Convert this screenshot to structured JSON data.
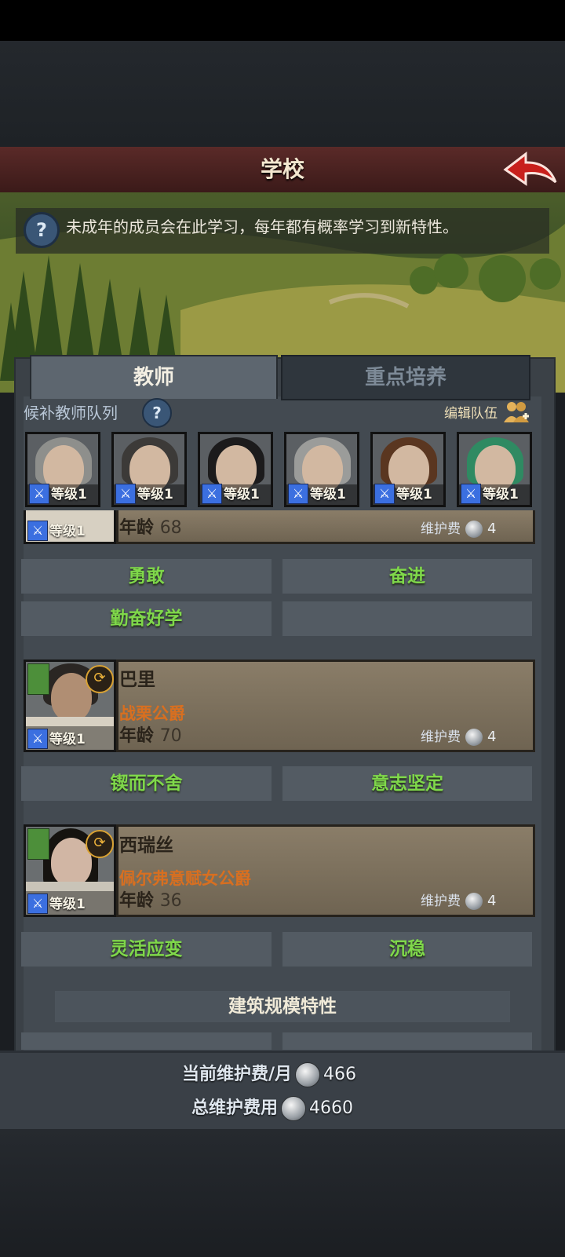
{
  "header": {
    "title": "学校"
  },
  "hint": {
    "text": "未成年的成员会在此学习，每年都有概率学习到新特性。",
    "icon": "question-icon"
  },
  "tabs": [
    {
      "label": "教师",
      "active": true
    },
    {
      "label": "重点培养",
      "active": false
    }
  ],
  "reserve": {
    "label": "候补教师队列",
    "edit_label": "编辑队伍",
    "members": [
      {
        "level": "等级1",
        "hair": "#8e8f8c"
      },
      {
        "level": "等级1",
        "hair": "#3c3a38"
      },
      {
        "level": "等级1",
        "hair": "#1c1b1c"
      },
      {
        "level": "等级1",
        "hair": "#9b9c9a"
      },
      {
        "level": "等级1",
        "hair": "#5a3620"
      },
      {
        "level": "等级1",
        "hair": "#2f8a62"
      }
    ]
  },
  "teachers": [
    {
      "name": "",
      "title": "",
      "age_label": "年龄",
      "age": "68",
      "level": "等级1",
      "fee_label": "维护费",
      "fee": "4",
      "traits": [
        "勇敢",
        "奋进",
        "勤奋好学",
        ""
      ]
    },
    {
      "name": "巴里",
      "title": "战栗公爵",
      "age_label": "年龄",
      "age": "70",
      "level": "等级1",
      "fee_label": "维护费",
      "fee": "4",
      "traits": [
        "锲而不舍",
        "意志坚定"
      ]
    },
    {
      "name": "西瑞丝",
      "title": "佩尔弗意赋女公爵",
      "age_label": "年龄",
      "age": "36",
      "level": "等级1",
      "fee_label": "维护费",
      "fee": "4",
      "traits": [
        "灵活应变",
        "沉稳"
      ]
    }
  ],
  "building_traits_label": "建筑规模特性",
  "maintenance": {
    "monthly_label": "当前维护费/月",
    "monthly_value": "466",
    "total_label": "总维护费用",
    "total_value": "4660"
  },
  "colors": {
    "trait_green": "#7fd84a",
    "title_orange": "#d86f20",
    "header_red": "#5a2a28"
  }
}
